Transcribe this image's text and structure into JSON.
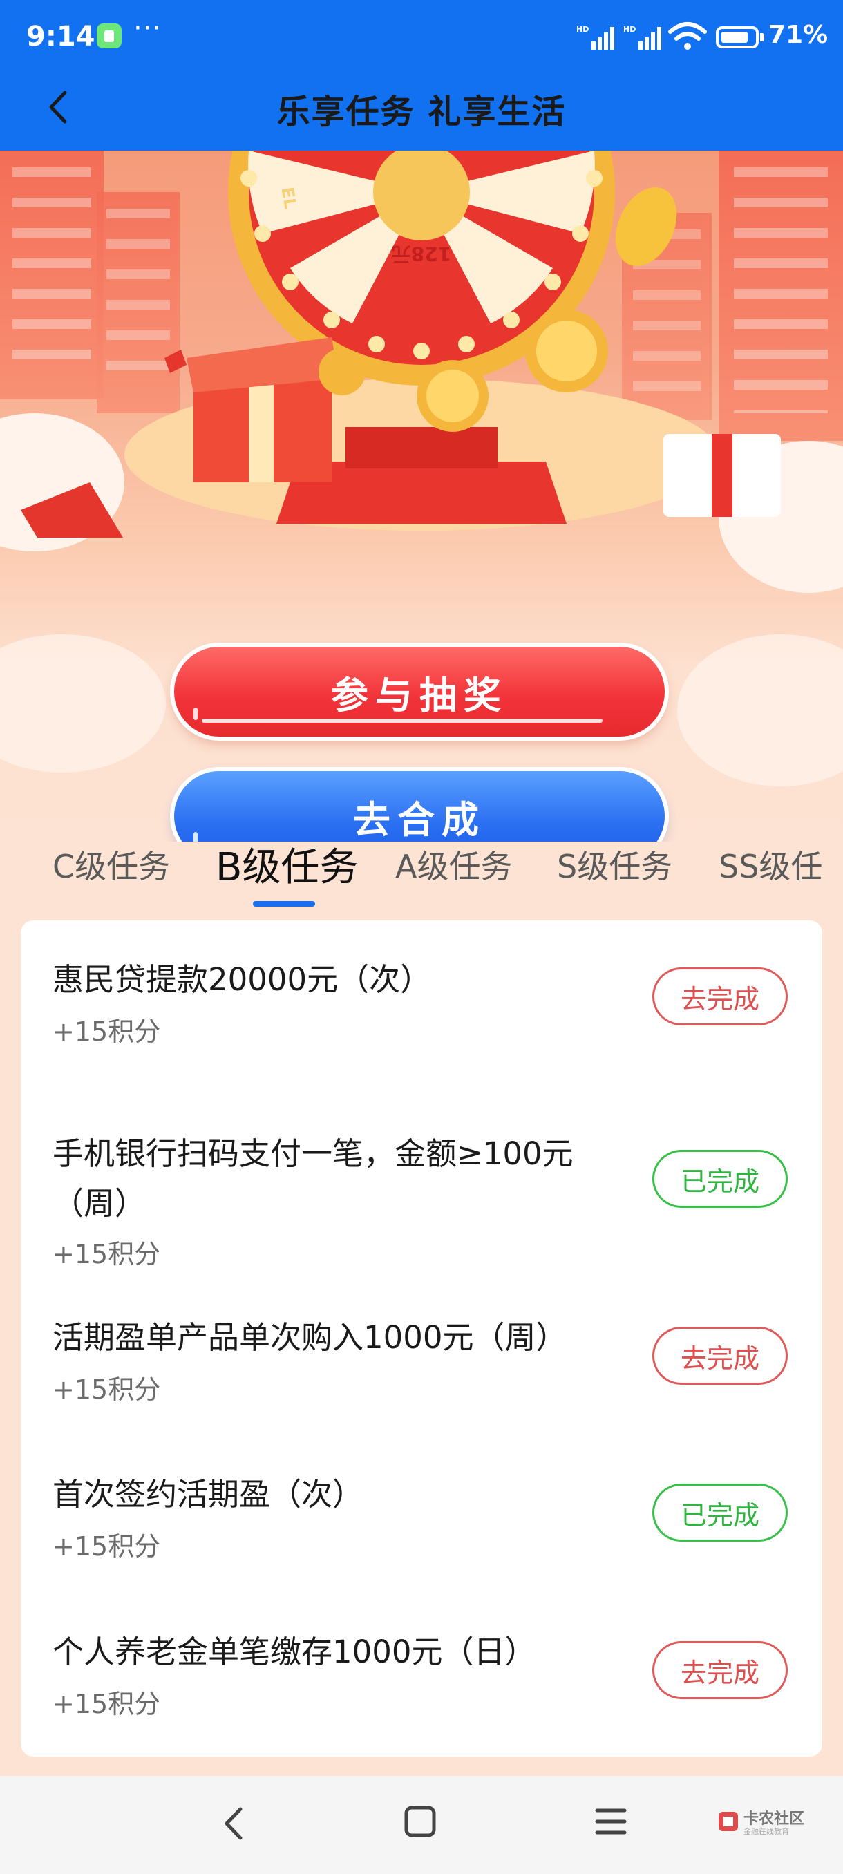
{
  "status_bar": {
    "time": "9:14",
    "more": "···",
    "battery": "71%"
  },
  "header": {
    "title": "乐享任务 礼享生活"
  },
  "hero": {
    "wheel_prize_text": "128元",
    "wheel_partial_text": "EL"
  },
  "actions": {
    "draw_label": "参与抽奖",
    "compose_label": "去合成"
  },
  "tabs": [
    {
      "label": "C级任务",
      "active": false
    },
    {
      "label": "B级任务",
      "active": true
    },
    {
      "label": "A级任务",
      "active": false
    },
    {
      "label": "S级任务",
      "active": false
    },
    {
      "label": "SS级任",
      "active": false
    }
  ],
  "tasks": [
    {
      "title": "惠民贷提款20000元（次）",
      "points": "+15积分",
      "action": "去完成",
      "status": "todo"
    },
    {
      "title": "手机银行扫码支付一笔，金额≥100元（周）",
      "points": "+15积分",
      "action": "已完成",
      "status": "done"
    },
    {
      "title": "活期盈单产品单次购入1000元（周）",
      "points": "+15积分",
      "action": "去完成",
      "status": "todo"
    },
    {
      "title": "首次签约活期盈（次）",
      "points": "+15积分",
      "action": "已完成",
      "status": "done"
    },
    {
      "title": "个人养老金单笔缴存1000元（日）",
      "points": "+15积分",
      "action": "去完成",
      "status": "todo"
    }
  ],
  "watermark": {
    "text": "卡农社区",
    "sub": "金融在线教育"
  },
  "colors": {
    "header_bg": "#1171f1",
    "draw_button": "#f2343a",
    "compose_button": "#2a6ef2",
    "tab_indicator": "#1a6ff0",
    "todo_red": "#df4f4f",
    "done_green": "#2eb53f"
  }
}
